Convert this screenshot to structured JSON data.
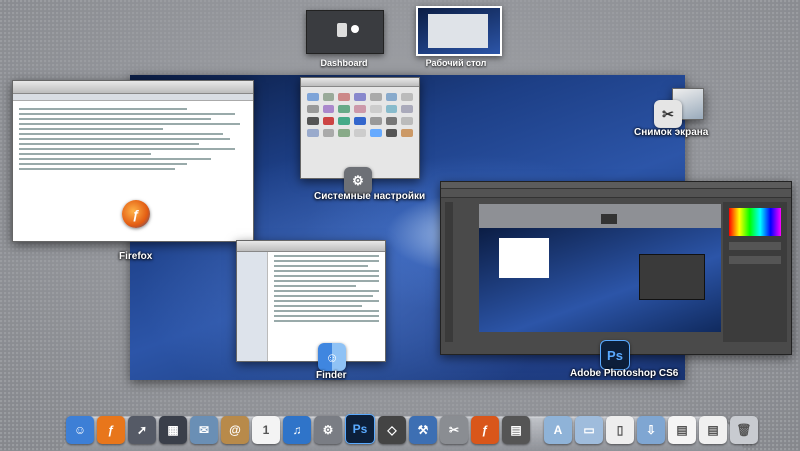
{
  "spaces": [
    {
      "label": "Dashboard"
    },
    {
      "label": "Рабочий стол"
    }
  ],
  "windows": {
    "firefox": {
      "label": "Firefox"
    },
    "system_prefs": {
      "label": "Системные настройки"
    },
    "screenshot": {
      "label": "Снимок экрана"
    },
    "finder": {
      "label": "Finder"
    },
    "photoshop": {
      "label": "Adobe Photoshop CS6",
      "icon_text": "Ps"
    }
  },
  "dock": {
    "items": [
      {
        "name": "finder-icon",
        "color": "#3d7fd6",
        "glyph": "☺"
      },
      {
        "name": "firefox-icon",
        "color": "#e8761b",
        "glyph": "ƒ"
      },
      {
        "name": "launchpad-icon",
        "color": "#555a66",
        "glyph": "➚"
      },
      {
        "name": "mission-control-icon",
        "color": "#3a3f4a",
        "glyph": "▦"
      },
      {
        "name": "preview-icon",
        "color": "#6a8fb5",
        "glyph": "✉"
      },
      {
        "name": "address-book-icon",
        "color": "#b88a4a",
        "glyph": "@"
      },
      {
        "name": "calendar-icon",
        "color": "#f4f4f4",
        "glyph": "1"
      },
      {
        "name": "itunes-icon",
        "color": "#2f74c9",
        "glyph": "♫"
      },
      {
        "name": "system-preferences-icon",
        "color": "#7a7d84",
        "glyph": "⚙"
      },
      {
        "name": "photoshop-icon",
        "color": "#0c1f3a",
        "glyph": "Ps"
      },
      {
        "name": "unity-icon",
        "color": "#444",
        "glyph": "◇"
      },
      {
        "name": "xcode-icon",
        "color": "#3d6fb3",
        "glyph": "⚒"
      },
      {
        "name": "utilities-icon",
        "color": "#8a8d92",
        "glyph": "✂"
      },
      {
        "name": "firefox-2-icon",
        "color": "#d9561a",
        "glyph": "ƒ"
      },
      {
        "name": "activity-monitor-icon",
        "color": "#555",
        "glyph": "▤"
      }
    ],
    "stack_items": [
      {
        "name": "applications-folder-icon",
        "color": "#8fb3d8",
        "glyph": "A"
      },
      {
        "name": "documents-folder-icon",
        "color": "#9fbcdc",
        "glyph": "▭"
      },
      {
        "name": "document-stack-icon",
        "color": "#eeeeee",
        "glyph": "▯"
      },
      {
        "name": "downloads-folder-icon",
        "color": "#7fa6d2",
        "glyph": "⇩"
      },
      {
        "name": "pdf-stack-icon",
        "color": "#f5f5f5",
        "glyph": "▤"
      },
      {
        "name": "files-stack-icon",
        "color": "#f0f0f0",
        "glyph": "▤"
      },
      {
        "name": "trash-icon",
        "color": "#c8cbd0",
        "glyph": "🗑"
      }
    ]
  }
}
